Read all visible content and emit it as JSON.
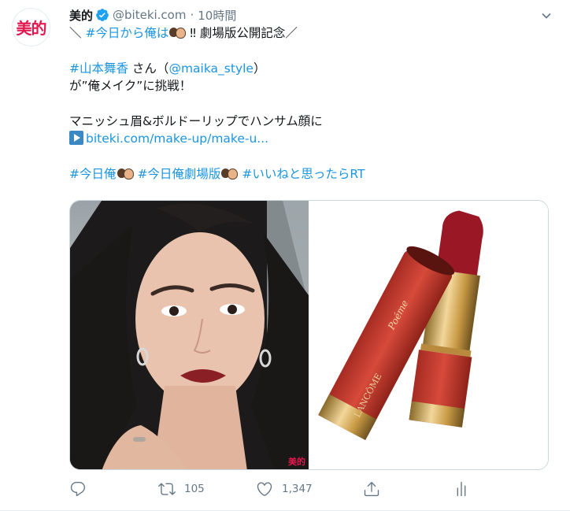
{
  "tweet": {
    "avatar_text": "美的",
    "display_name": "美的",
    "handle": "@biteki.com",
    "separator": "·",
    "time": "10時間",
    "lines": {
      "l1_prefix": "＼ ",
      "l1_tag": "#今日から俺は",
      "l1_suffix": " ‼ 劇場版公開記念／",
      "l2_tag": "#山本舞香",
      "l2_mid": " さん（",
      "l2_mention": "@maika_style",
      "l2_end": "）",
      "l3": "が”俺メイク”に挑戦！",
      "l4": "マニッシュ眉&ボルドーリップでハンサム顔に",
      "l5_link": "biteki.com/make-up/make-u...",
      "l6_tag1": "#今日俺",
      "l6_tag2": "#今日俺劇場版",
      "l6_tag3": "#いいねと思ったらRT"
    },
    "media": {
      "left_image": "portrait-photo",
      "right_image": "lipstick-photo",
      "watermark": "美的",
      "lipstick_brand": "LANCÔME"
    },
    "actions": {
      "reply_count": "",
      "retweet_count": "105",
      "like_count": "1,347"
    }
  },
  "colors": {
    "link": "#1b95e0",
    "verified": "#1da1f2",
    "muted": "#657786",
    "brand": "#e3174f"
  },
  "icons": [
    "verified-badge-icon",
    "chevron-down-icon",
    "play-icon",
    "reply-icon",
    "retweet-icon",
    "like-icon",
    "share-icon",
    "analytics-icon"
  ]
}
